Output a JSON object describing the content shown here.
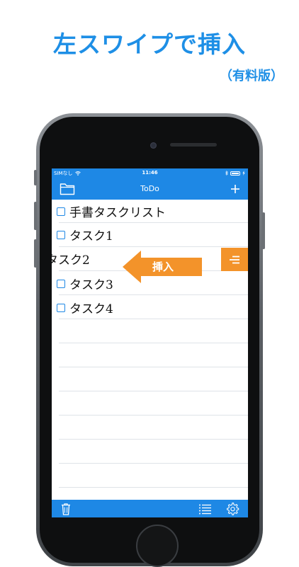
{
  "promo": {
    "headline": "左スワイプで挿入",
    "subline": "（有料版）"
  },
  "status_bar": {
    "carrier": "SIMなし",
    "time": "11:46"
  },
  "nav": {
    "title": "ToDo"
  },
  "tasks": [
    {
      "label": "手書タスクリスト",
      "checked": false
    },
    {
      "label": "タスク1",
      "checked": false
    },
    {
      "label": "タスク2",
      "checked": false,
      "swiped": true
    },
    {
      "label": "タスク3",
      "checked": false
    },
    {
      "label": "タスク4",
      "checked": false
    }
  ],
  "swipe_hint": {
    "label": "挿入"
  },
  "icons": {
    "folder": "folder-icon",
    "add": "plus-icon",
    "insert_action": "insert-lines-icon",
    "trash": "trash-icon",
    "list": "list-icon",
    "settings": "gear-icon"
  },
  "colors": {
    "accent": "#1e88e5",
    "headline": "#1e8fe6",
    "swipe": "#f3932a"
  }
}
